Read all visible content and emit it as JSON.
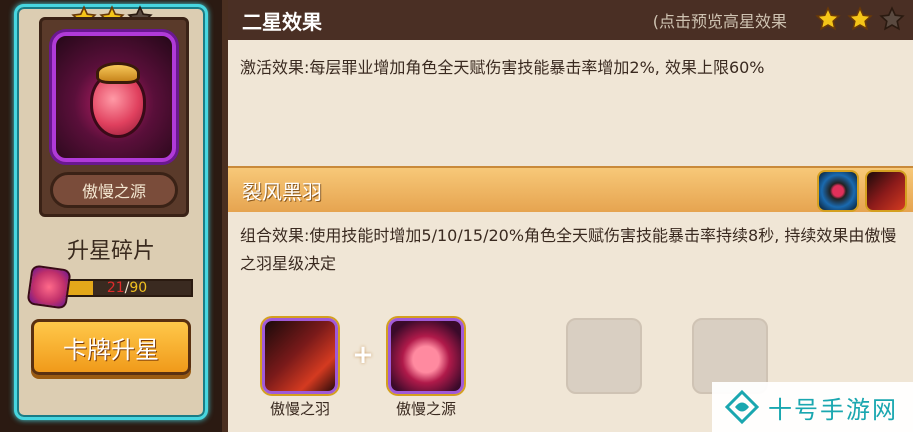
{
  "card": {
    "stars_filled": 2,
    "stars_total": 3,
    "name": "傲慢之源",
    "shard_title": "升星碎片",
    "progress": {
      "current": "21",
      "separator": "/",
      "max": "90",
      "fraction": 0.233
    },
    "upgrade_button": "卡牌升星"
  },
  "panel": {
    "title": "二星效果",
    "hint": "(点击预览高星效果",
    "header_stars_filled": 2,
    "header_stars_total": 3,
    "effect_text": "激活效果:每层罪业增加角色全天赋伤害技能暴击率增加2%, 效果上限60%",
    "set": {
      "title": "裂风黑羽",
      "icons": [
        "helmet-icon",
        "wing-icon"
      ],
      "combo_text": "组合效果:使用技能时增加5/10/15/20%角色全天赋伤害技能暴击率持续8秒, 持续效果由傲慢之羽星级决定"
    },
    "slots": [
      {
        "label": "傲慢之羽",
        "icon": "wing-icon"
      },
      {
        "label": "傲慢之源",
        "icon": "gem-icon"
      }
    ],
    "plus": "+"
  },
  "watermark": {
    "text": "十号手游网"
  },
  "colors": {
    "accent_orange": "#f0a030",
    "header_bg": "#4a2f24",
    "card_border": "#47d6e0",
    "star_gold": "#f5c518"
  }
}
